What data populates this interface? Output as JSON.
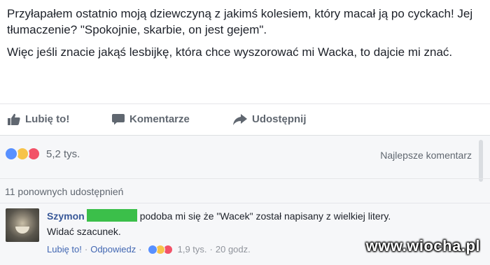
{
  "post": {
    "paragraph1": "Przyłapałem ostatnio moją dziewczyną z jakimś kolesiem, który macał ją po cyckach! Jej tłumaczenie? \"Spokojnie, skarbie, on jest gejem\".",
    "paragraph2": "Więc jeśli znacie jakąś lesbijkę, która chce wyszorować mi Wacka, to dajcie mi znać."
  },
  "actions": {
    "like_label": "Lubię to!",
    "comment_label": "Komentarze",
    "share_label": "Udostępnij"
  },
  "reactions": {
    "count": "5,2 tys.",
    "icons": [
      "like-icon",
      "haha-icon",
      "love-icon"
    ],
    "colors": {
      "like": "#5890ff",
      "haha": "#f7c34a",
      "love": "#f25268"
    }
  },
  "sort": {
    "label": "Najlepsze komentarz"
  },
  "shares": {
    "label": "11 ponownych udostępnień"
  },
  "comment": {
    "author": "Szymon",
    "text_line1": "podoba mi się  że \"Wacek\" został napisany z wielkiej litery.",
    "text_line2": "Widać szacunek.",
    "censor_color": "#3bbf4a",
    "like_label": "Lubię to!",
    "reply_label": "Odpowiedz",
    "reaction_count": "1,9 tys.",
    "time": "20 godz."
  },
  "watermark": "www.wiocha.pl"
}
